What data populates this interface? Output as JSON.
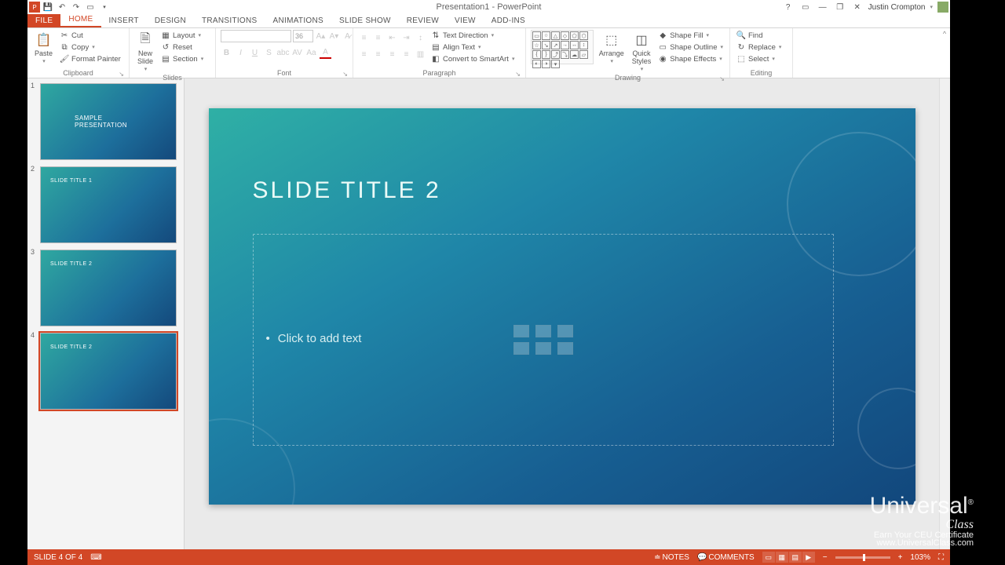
{
  "title": "Presentation1 - PowerPoint",
  "user": "Justin Crompton",
  "tabs": [
    "FILE",
    "HOME",
    "INSERT",
    "DESIGN",
    "TRANSITIONS",
    "ANIMATIONS",
    "SLIDE SHOW",
    "REVIEW",
    "VIEW",
    "ADD-INS"
  ],
  "activeTab": "HOME",
  "ribbon": {
    "clipboard": {
      "label": "Clipboard",
      "paste": "Paste",
      "cut": "Cut",
      "copy": "Copy",
      "formatPainter": "Format Painter"
    },
    "slides": {
      "label": "Slides",
      "newSlide": "New\nSlide",
      "layout": "Layout",
      "reset": "Reset",
      "section": "Section"
    },
    "font": {
      "label": "Font",
      "size": "36"
    },
    "paragraph": {
      "label": "Paragraph",
      "textDirection": "Text Direction",
      "alignText": "Align Text",
      "convert": "Convert to SmartArt"
    },
    "drawing": {
      "label": "Drawing",
      "arrange": "Arrange",
      "quickStyles": "Quick\nStyles",
      "shapeFill": "Shape Fill",
      "shapeOutline": "Shape Outline",
      "shapeEffects": "Shape Effects"
    },
    "editing": {
      "label": "Editing",
      "find": "Find",
      "replace": "Replace",
      "select": "Select"
    }
  },
  "thumbnails": [
    {
      "num": "1",
      "title": "SAMPLE PRESENTATION",
      "layout": "center"
    },
    {
      "num": "2",
      "title": "SLIDE TITLE 1",
      "layout": "tl"
    },
    {
      "num": "3",
      "title": "SLIDE TITLE 2",
      "layout": "tl"
    },
    {
      "num": "4",
      "title": "SLIDE TITLE 2",
      "layout": "tl",
      "active": true
    }
  ],
  "slide": {
    "title": "SLIDE TITLE 2",
    "placeholder": "Click to add text"
  },
  "status": {
    "slideOf": "SLIDE 4 OF 4",
    "notes": "NOTES",
    "comments": "COMMENTS",
    "zoom": "103%"
  },
  "watermark": {
    "logo": "Universal",
    "sub": "Class",
    "line1": "Earn Your CEU Certificate",
    "line2": "www.UniversalClass.com"
  }
}
